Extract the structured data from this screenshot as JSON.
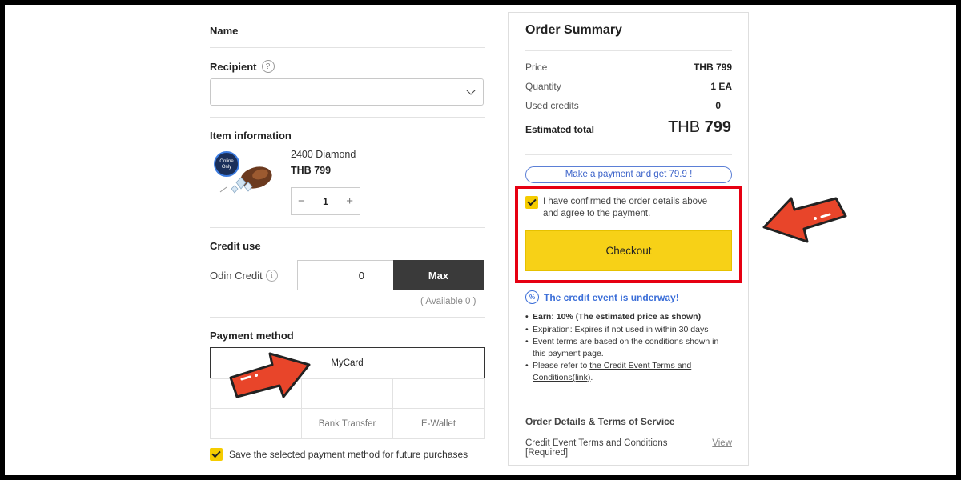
{
  "left": {
    "name_label": "Name",
    "recipient_label": "Recipient",
    "recipient_help": "?",
    "recipient_value": "",
    "item_info_label": "Item information",
    "item": {
      "name": "2400 Diamond",
      "price": "THB 799",
      "badge": "Online Only",
      "quantity": "1",
      "minus": "−",
      "plus": "+"
    },
    "credit_use_label": "Credit use",
    "odin_credit_label": "Odin Credit",
    "info_glyph": "i",
    "credit_value": "0",
    "max_label": "Max",
    "available_text": "( Available 0      )",
    "payment_method_label": "Payment method",
    "payment_methods": [
      "MyCard",
      "",
      "",
      "",
      "",
      "Bank Transfer",
      "E-Wallet"
    ],
    "save_method_label": "Save the selected payment method for future purchases"
  },
  "summary": {
    "title": "Order Summary",
    "rows": [
      {
        "label": "Price",
        "value": "THB 799"
      },
      {
        "label": "Quantity",
        "value": "1 EA"
      },
      {
        "label": "Used credits",
        "value": "0"
      }
    ],
    "total_label": "Estimated total",
    "total_currency": "THB",
    "total_amount": "799",
    "promo_text": "Make a payment and get 79.9      !",
    "agree_text": "I have confirmed the order details above and agree to the payment.",
    "checkout_label": "Checkout",
    "event_icon": "%",
    "event_title": "The credit event is underway!",
    "event_earn": "Earn: 10% (The estimated price as shown)",
    "event_expiration": "Expiration: Expires if not used in within 30 days",
    "event_terms": "Event terms are based on the conditions shown in this payment page.",
    "event_refer_prefix": "Please refer to ",
    "event_refer_link": "the Credit Event Terms and Conditions(link)",
    "event_refer_suffix": ".",
    "order_details_title": "Order Details & Terms of Service",
    "terms_item": "Credit Event Terms and Conditions [Required]",
    "view_label": "View"
  },
  "colors": {
    "checkout": "#f7d117",
    "highlight": "#e60012",
    "event": "#3b6ed8",
    "max_button": "#3a3a3a"
  }
}
